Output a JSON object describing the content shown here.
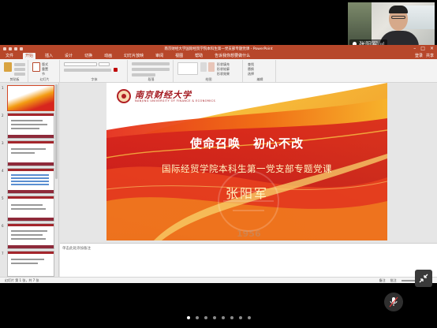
{
  "video": {
    "participant_name": "张阳军",
    "signal": "ııl"
  },
  "ppt": {
    "window_title": "南京财经大学国际经贸学院本科生第一党支部专题党课 - PowerPoint",
    "window_controls": [
      "–",
      "□",
      "×"
    ],
    "tabs": [
      "文件",
      "开始",
      "插入",
      "设计",
      "切换",
      "动画",
      "幻灯片放映",
      "审阅",
      "视图",
      "帮助",
      "告诉我你想要做什么"
    ],
    "active_tab": "开始",
    "user": "登录",
    "share": "共享",
    "ribbon_groups": [
      "剪贴板",
      "幻灯片",
      "字体",
      "段落",
      "绘图",
      "编辑"
    ],
    "ribbon_items": {
      "new_slide": "新建幻灯片",
      "layout": "版式",
      "reset": "重置",
      "section": "节",
      "find": "查找",
      "replace": "替换",
      "select": "选择",
      "shape_fill": "形状填充",
      "shape_outline": "形状轮廓",
      "shape_effect": "形状效果",
      "arrange": "排列",
      "quick_styles": "快速样式"
    },
    "slide_numbers": [
      "1",
      "2",
      "3",
      "4",
      "5",
      "6",
      "7"
    ],
    "slide": {
      "univ_name": "南京财经大学",
      "univ_eng": "NANJING UNIVERSITY OF FINANCE & ECONOMICS",
      "title": "使命召唤　初心不改",
      "subtitle": "国际经贸学院本科生第一党支部专题党课",
      "speaker": "张阳军",
      "year": "1956"
    },
    "notes_placeholder": "单击此处添加备注",
    "status_left": "幻灯片 第 1 张，共 7 张",
    "status_notes": "备注",
    "status_comments": "批注",
    "zoom": "+"
  },
  "meeting": {
    "page_count": 8,
    "active_page": 0
  }
}
